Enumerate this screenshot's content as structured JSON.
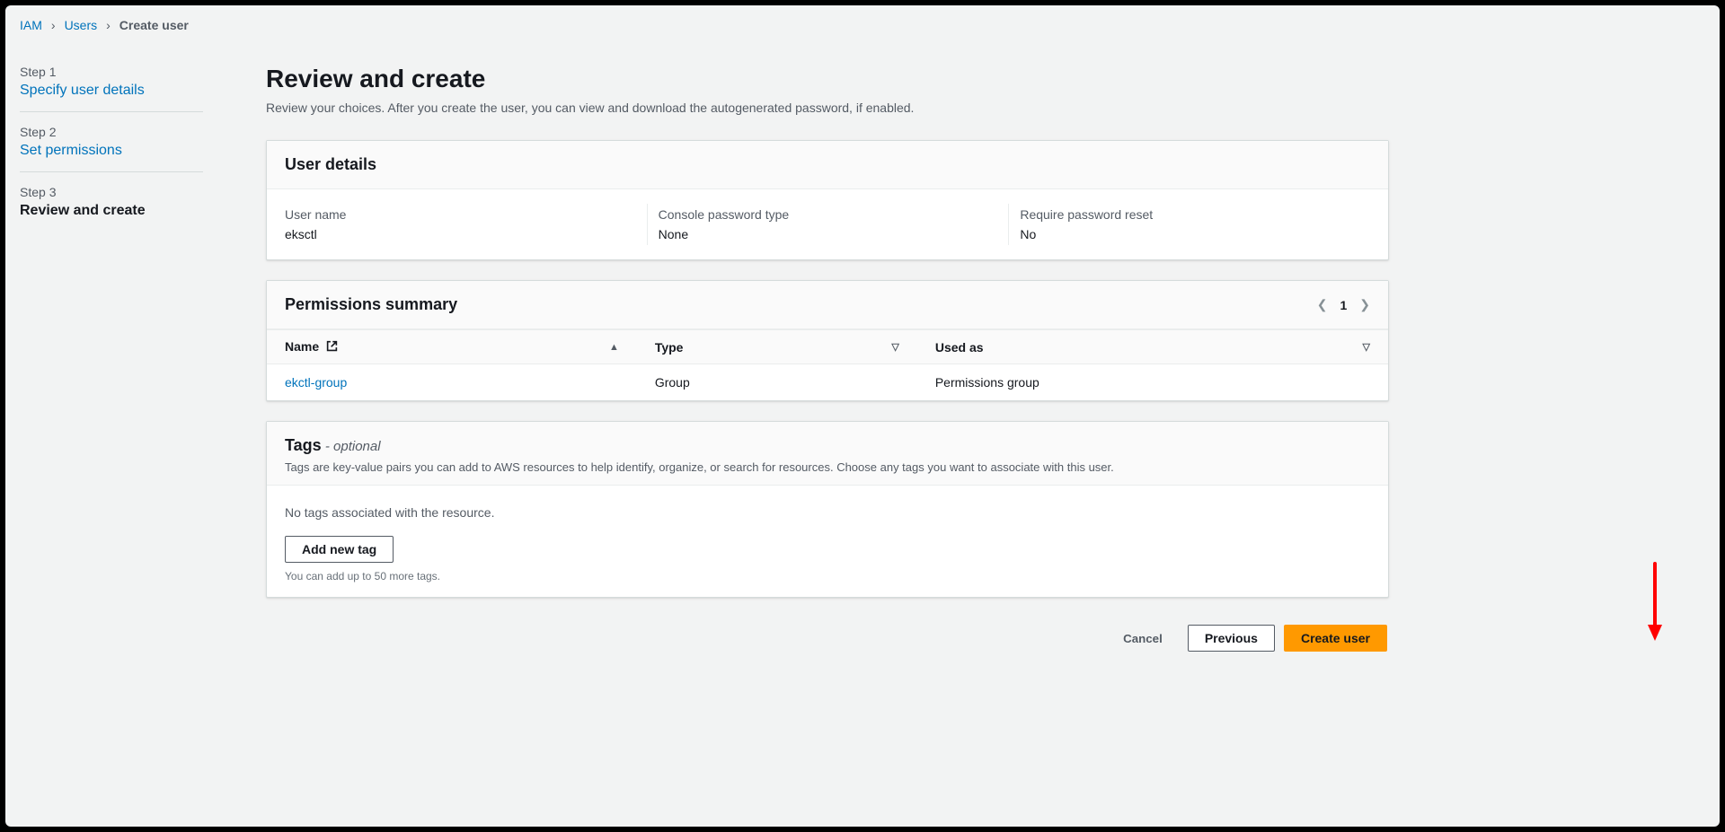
{
  "breadcrumb": {
    "iam": "IAM",
    "users": "Users",
    "current": "Create user"
  },
  "steps": {
    "s1_label": "Step 1",
    "s1_link": "Specify user details",
    "s2_label": "Step 2",
    "s2_link": "Set permissions",
    "s3_label": "Step 3",
    "s3_current": "Review and create"
  },
  "page": {
    "title": "Review and create",
    "description": "Review your choices. After you create the user, you can view and download the autogenerated password, if enabled."
  },
  "user_details": {
    "panel_title": "User details",
    "username_label": "User name",
    "username_value": "eksctl",
    "pwdtype_label": "Console password type",
    "pwdtype_value": "None",
    "reset_label": "Require password reset",
    "reset_value": "No"
  },
  "permissions": {
    "panel_title": "Permissions summary",
    "page_number": "1",
    "columns": {
      "name": "Name",
      "type": "Type",
      "used_as": "Used as"
    },
    "rows": [
      {
        "name": "ekctl-group",
        "type": "Group",
        "used_as": "Permissions group"
      }
    ]
  },
  "tags": {
    "title": "Tags",
    "optional": " - optional",
    "description": "Tags are key-value pairs you can add to AWS resources to help identify, organize, or search for resources. Choose any tags you want to associate with this user.",
    "none_msg": "No tags associated with the resource.",
    "add_button": "Add new tag",
    "hint": "You can add up to 50 more tags."
  },
  "footer": {
    "cancel": "Cancel",
    "previous": "Previous",
    "create": "Create user"
  }
}
